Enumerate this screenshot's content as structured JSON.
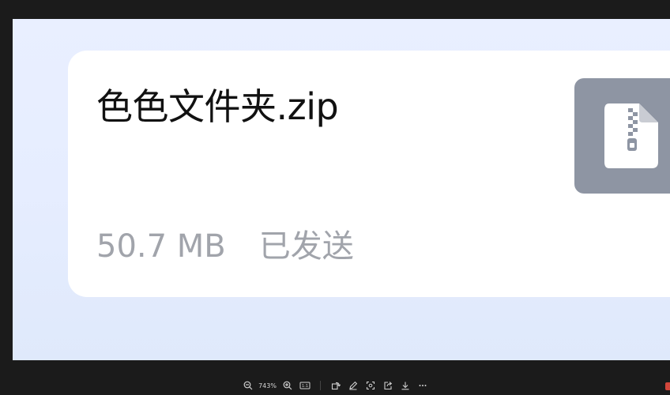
{
  "file_card": {
    "name": "色色文件夹.zip",
    "size": "50.7 MB",
    "status": "已发送",
    "icon": "zip-file-icon"
  },
  "toolbar": {
    "zoom_level": "743%",
    "actual_size_label": "1:1",
    "items": [
      "zoom-out-icon",
      "zoom-in-icon",
      "actual-size-icon",
      "rotate-icon",
      "edit-icon",
      "crop-icon",
      "share-icon",
      "download-icon",
      "more-icon"
    ]
  },
  "colors": {
    "viewer_bg": "#1b1b1b",
    "card_bg": "#ffffff",
    "image_bg": "#e7eeff",
    "icon_tile": "#8e95a3",
    "meta_text": "#a1a4ab"
  }
}
